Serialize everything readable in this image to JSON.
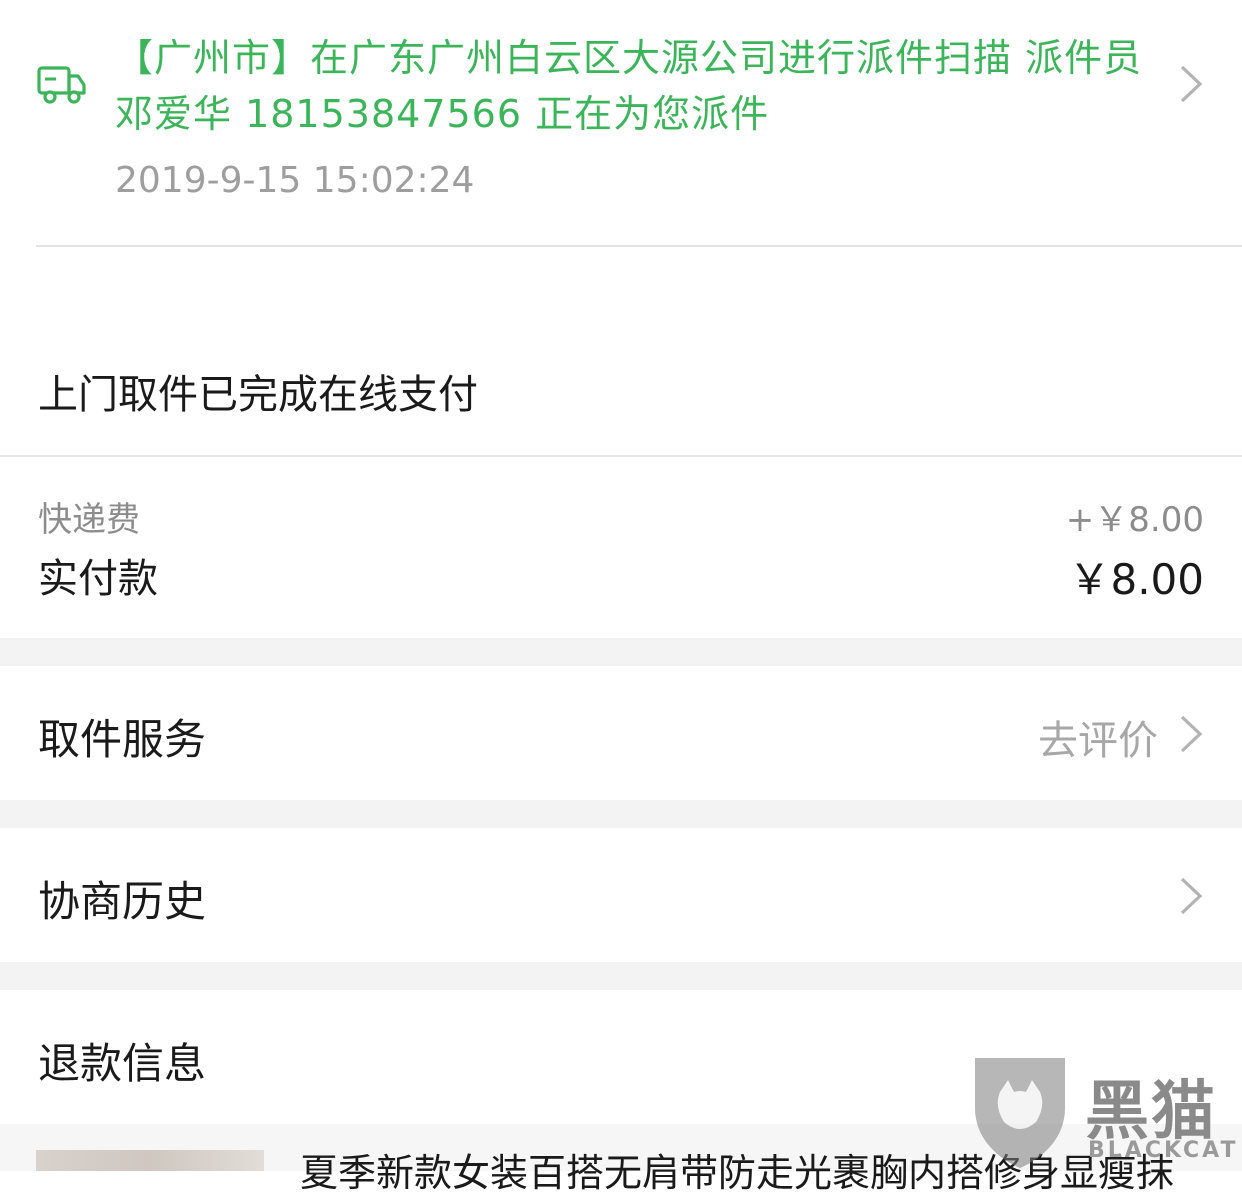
{
  "logistics": {
    "cut_line": "",
    "description": "【广州市】在广东广州白云区大源公司进行派件扫描 派件员 邓爱华 18153847566 正在为您派件",
    "time": "2019-9-15 15:02:24",
    "icon": "truck-icon",
    "accent_color": "#3cb55a"
  },
  "status": {
    "text": "上门取件已完成在线支付"
  },
  "payment": {
    "fee_label": "快递费",
    "fee_value": "+￥8.00",
    "paid_label": "实付款",
    "paid_value": "￥8.00"
  },
  "pickup_service": {
    "title": "取件服务",
    "action": "去评价"
  },
  "negotiation": {
    "title": "协商历史"
  },
  "refund": {
    "title": "退款信息"
  },
  "product": {
    "title": "夏季新款女装百搭无肩带防走光裹胸内搭修身显瘦抹"
  },
  "watermark": {
    "cn": "黑猫",
    "en": "BLACKCAT"
  }
}
